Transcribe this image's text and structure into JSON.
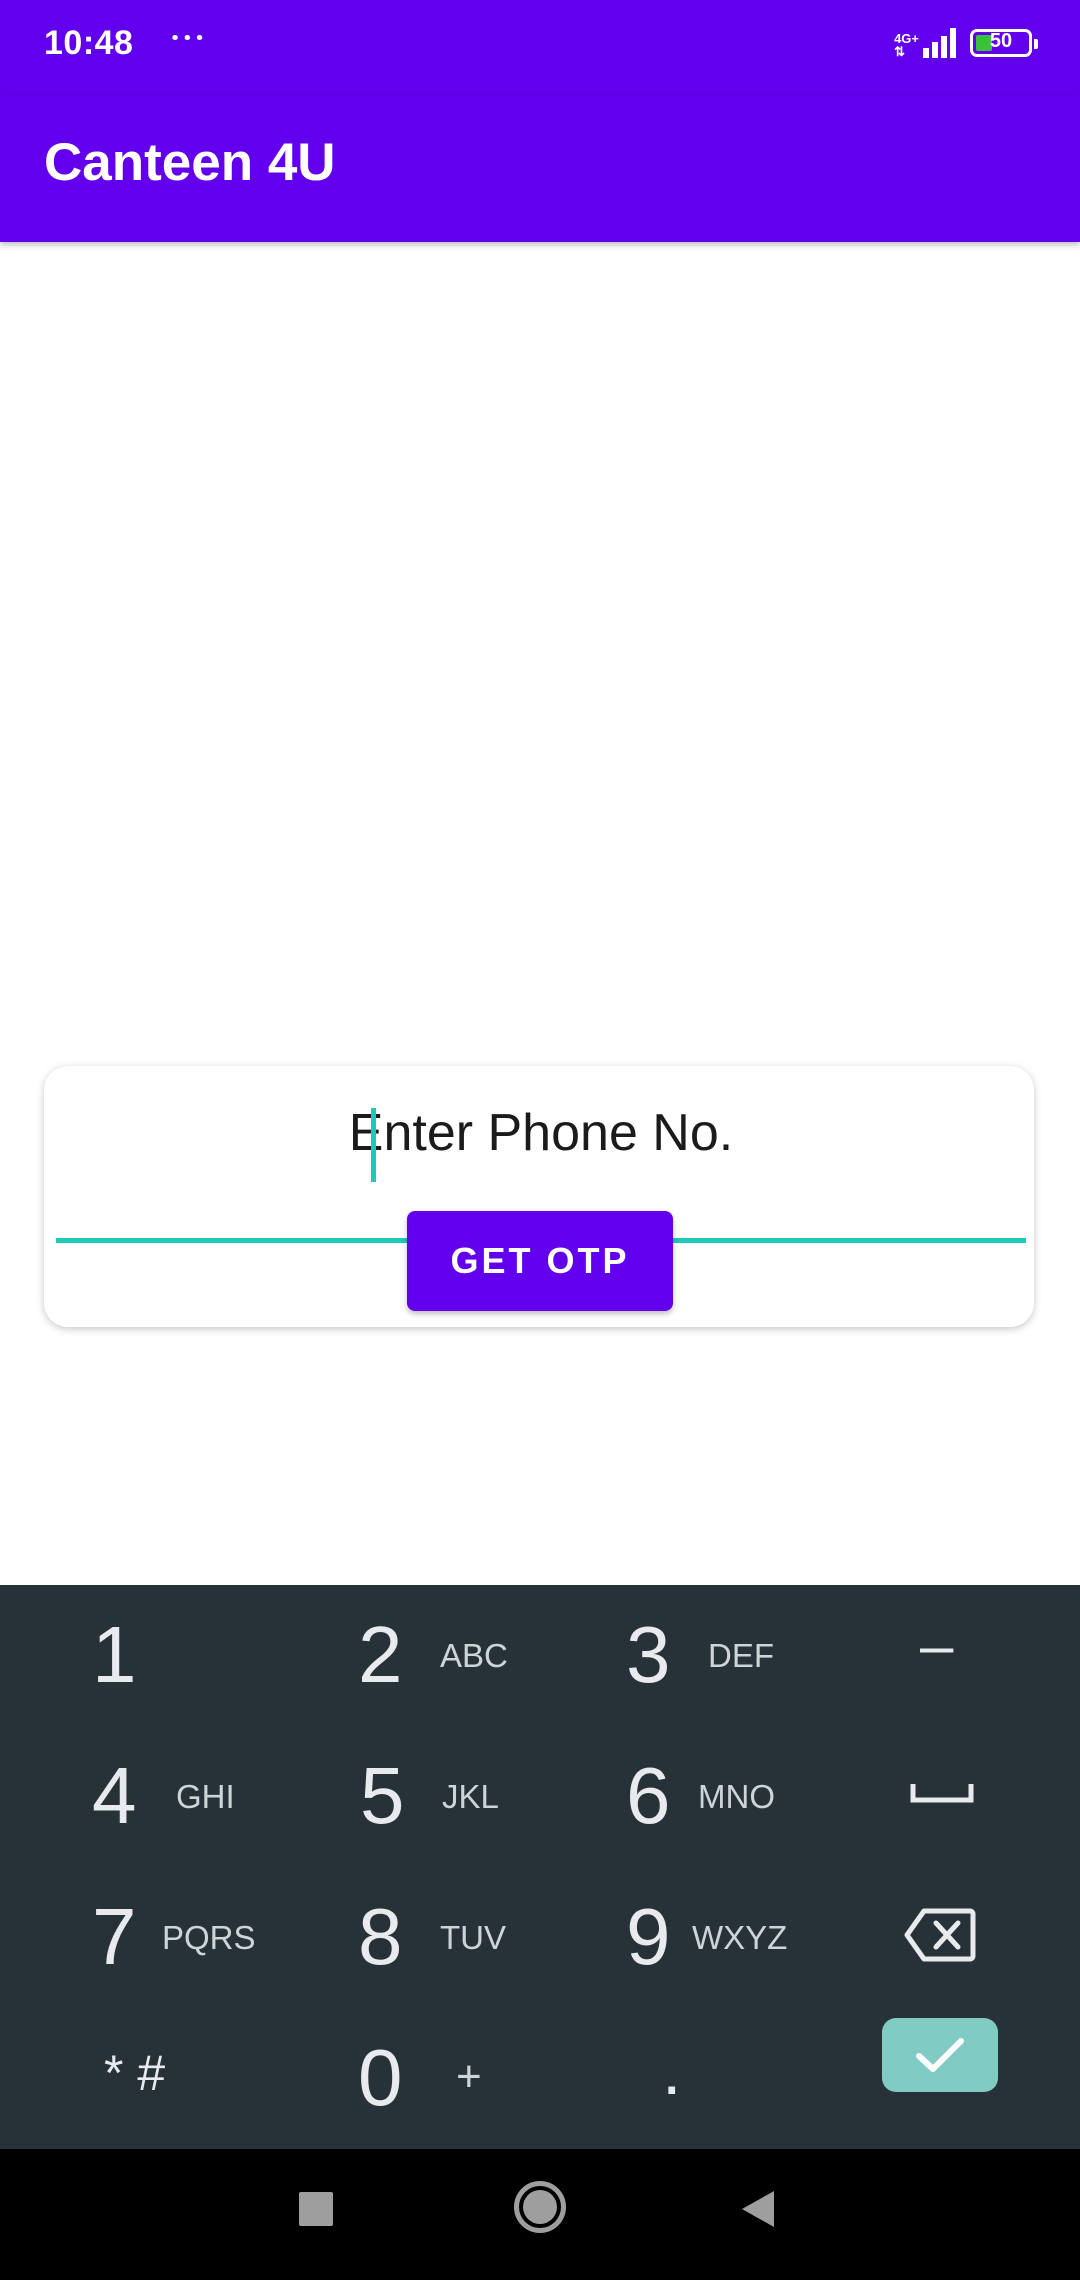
{
  "status_bar": {
    "time": "10:48",
    "notification_dots": "···",
    "network_type": "4G+",
    "battery_level": "50"
  },
  "app_bar": {
    "title": "Canteen 4U"
  },
  "login_card": {
    "phone_placeholder": "Enter Phone No.",
    "phone_value": "",
    "get_otp_label": "GET OTP"
  },
  "keyboard": {
    "keys": [
      {
        "num": "1",
        "sub": ""
      },
      {
        "num": "2",
        "sub": "ABC"
      },
      {
        "num": "3",
        "sub": "DEF"
      },
      {
        "num": "4",
        "sub": "GHI"
      },
      {
        "num": "5",
        "sub": "JKL"
      },
      {
        "num": "6",
        "sub": "MNO"
      },
      {
        "num": "7",
        "sub": "PQRS"
      },
      {
        "num": "8",
        "sub": "TUV"
      },
      {
        "num": "9",
        "sub": "WXYZ"
      },
      {
        "num": "* #",
        "sub": ""
      },
      {
        "num": "0",
        "sub": "+"
      },
      {
        "num": ".",
        "sub": ""
      }
    ],
    "minus_label": "–",
    "done_color": "#80cbc4"
  },
  "colors": {
    "primary": "#6200ee",
    "accent": "#1fc9b9",
    "keyboard_bg": "#263238"
  }
}
